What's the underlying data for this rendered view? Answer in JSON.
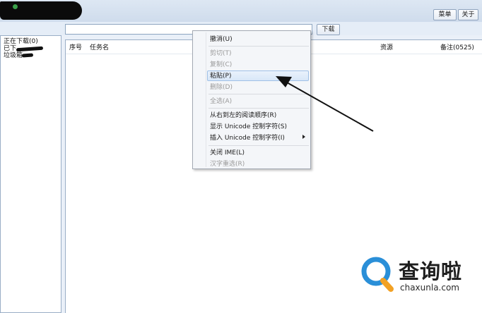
{
  "top_buttons": {
    "menu_label": "菜单",
    "about_label": "关于"
  },
  "toolbar": {
    "url_value": "",
    "download_label": "下载"
  },
  "sidebar": {
    "items": [
      {
        "label": "正在下载(0)"
      },
      {
        "label": "已下"
      },
      {
        "label": "垃圾箱"
      }
    ]
  },
  "task_list": {
    "columns": {
      "index": "序号",
      "task_name": "任务名",
      "resource": "资源",
      "note": "备注(0525)"
    }
  },
  "context_menu": {
    "items": [
      {
        "label": "撤消(U)",
        "enabled": true
      },
      {
        "label": "剪切(T)",
        "enabled": false
      },
      {
        "label": "复制(C)",
        "enabled": false
      },
      {
        "label": "粘贴(P)",
        "enabled": true,
        "highlighted": true
      },
      {
        "label": "删除(D)",
        "enabled": false
      },
      {
        "label": "全选(A)",
        "enabled": false
      },
      {
        "label": "从右到左的阅读顺序(R)",
        "enabled": true
      },
      {
        "label": "显示 Unicode 控制字符(S)",
        "enabled": true
      },
      {
        "label": "插入 Unicode 控制字符(I)",
        "enabled": true,
        "submenu": true
      },
      {
        "label": "关闭 IME(L)",
        "enabled": true
      },
      {
        "label": "汉字重选(R)",
        "enabled": false
      }
    ]
  },
  "watermark": {
    "title": "查询啦",
    "url": "chaxunla.com"
  },
  "colors": {
    "highlight": "#d8e7f8",
    "watermark_blue": "#2a8fd8",
    "watermark_orange": "#f2a124"
  }
}
